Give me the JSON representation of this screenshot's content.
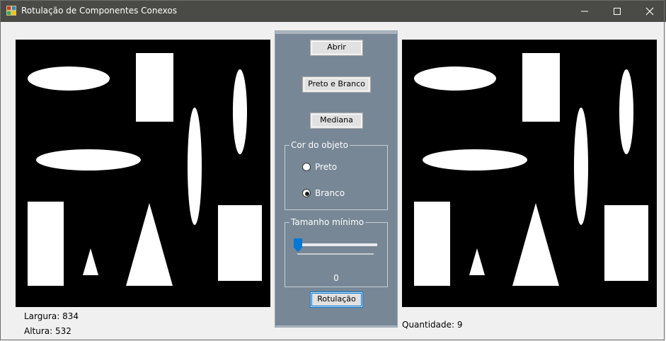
{
  "window": {
    "title": "Rotulação de Componentes Conexos"
  },
  "controls": {
    "open_label": "Abrir",
    "bw_label": "Preto e Branco",
    "median_label": "Mediana",
    "label_button": "Rotulação"
  },
  "object_color": {
    "legend": "Cor do objeto",
    "options": [
      {
        "label": "Preto",
        "selected": false
      },
      {
        "label": "Branco",
        "selected": true
      }
    ]
  },
  "min_size": {
    "legend": "Tamanho mínimo",
    "value": "0",
    "slider_fraction": 0
  },
  "image_info": {
    "width_text": "Largura: 834",
    "height_text": "Altura: 532"
  },
  "result": {
    "count_text": "Quantidade: 9"
  },
  "colors": {
    "titlebar": "#4a4a46",
    "panel": "#778796",
    "image_background": "#000000",
    "shapes": "#ffffff",
    "slider_thumb": "#0078d7"
  },
  "icons": {
    "app": "app-icon",
    "minimize": "minimize-icon",
    "maximize": "maximize-icon",
    "close": "close-icon"
  }
}
